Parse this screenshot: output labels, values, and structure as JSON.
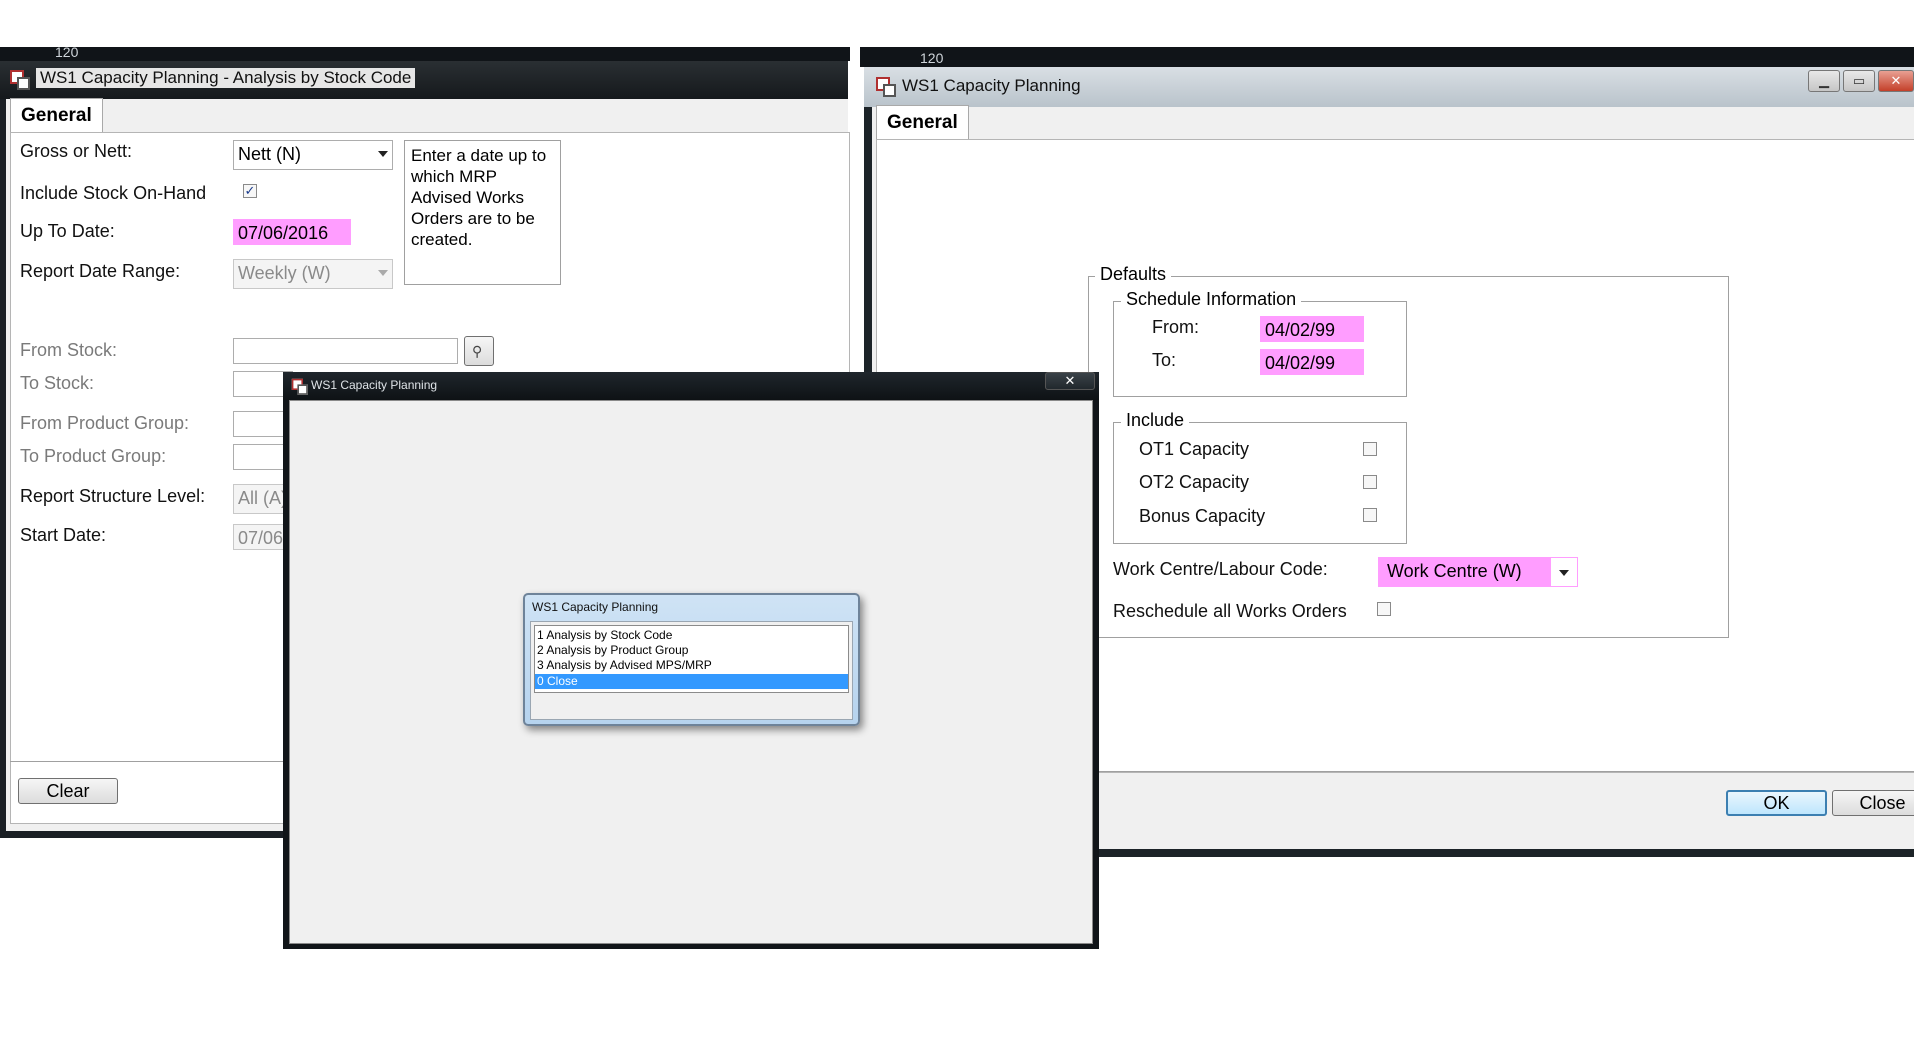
{
  "strips": {
    "left_text": "120",
    "right_text": "120"
  },
  "left_window": {
    "title": "WS1  Capacity Planning - Analysis by Stock Code",
    "tab": "General",
    "gross_or_nett_label": "Gross or Nett:",
    "gross_or_nett_value": "Nett (N)",
    "include_stock_label": "Include Stock On-Hand",
    "include_stock_checked": true,
    "up_to_date_label": "Up To Date:",
    "up_to_date_value": "07/06/2016",
    "report_date_range_label": "Report Date Range:",
    "report_date_range_value": "Weekly (W)",
    "hint": "Enter a date up to which MRP Advised Works Orders are to be created.",
    "from_stock_label": "From Stock:",
    "to_stock_label": "To Stock:",
    "from_product_group_label": "From Product Group:",
    "to_product_group_label": "To Product Group:",
    "report_structure_label": "Report Structure Level:",
    "report_structure_value": "All (A)",
    "start_date_label": "Start Date:",
    "start_date_value": "07/06/",
    "clear_button": "Clear"
  },
  "right_window": {
    "title": "WS1  Capacity Planning",
    "tab": "General",
    "defaults_legend": "Defaults",
    "schedule_legend": "Schedule Information",
    "from_label": "From:",
    "from_value": "04/02/99",
    "to_label": "To:",
    "to_value": "04/02/99",
    "include_legend": "Include",
    "ot1_label": "OT1 Capacity",
    "ot2_label": "OT2 Capacity",
    "bonus_label": "Bonus Capacity",
    "work_centre_label": "Work Centre/Labour Code:",
    "work_centre_value": "Work Centre (W)",
    "reschedule_label": "Reschedule all Works Orders",
    "ok_button": "OK",
    "close_button": "Close"
  },
  "middle_window": {
    "title": "WS1  Capacity Planning",
    "close_glyph": "✕"
  },
  "menu_dialog": {
    "title": "WS1  Capacity Planning",
    "items": [
      "1 Analysis by Stock Code",
      "2 Analysis by Product Group",
      "3 Analysis by Advised MPS/MRP",
      "0 Close"
    ],
    "selected_index": 3
  }
}
